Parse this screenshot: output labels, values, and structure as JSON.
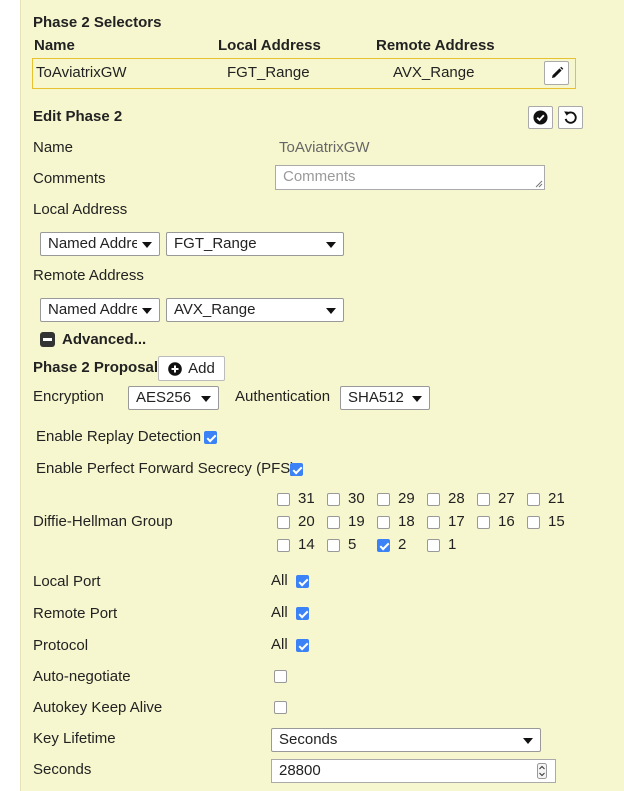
{
  "selectors": {
    "title": "Phase 2 Selectors",
    "columns": [
      "Name",
      "Local Address",
      "Remote Address"
    ],
    "row": {
      "name": "ToAviatrixGW",
      "local": "FGT_Range",
      "remote": "AVX_Range"
    }
  },
  "edit": {
    "title": "Edit Phase 2",
    "name_label": "Name",
    "name_value": "ToAviatrixGW",
    "comments_label": "Comments",
    "comments_placeholder": "Comments",
    "local_address_label": "Local Address",
    "local_type": "Named Address",
    "local_value": "FGT_Range",
    "remote_address_label": "Remote Address",
    "remote_type": "Named Address",
    "remote_value": "AVX_Range",
    "advanced_label": "Advanced..."
  },
  "proposal": {
    "title": "Phase 2 Proposal",
    "add_label": "Add",
    "encryption_label": "Encryption",
    "encryption_value": "AES256",
    "authentication_label": "Authentication",
    "authentication_value": "SHA512"
  },
  "options": {
    "replay_label": "Enable Replay Detection",
    "replay_checked": true,
    "pfs_label": "Enable Perfect Forward Secrecy (PFS)",
    "pfs_checked": true,
    "dh_label": "Diffie-Hellman Group",
    "dh_groups": [
      {
        "value": "31",
        "checked": false
      },
      {
        "value": "30",
        "checked": false
      },
      {
        "value": "29",
        "checked": false
      },
      {
        "value": "28",
        "checked": false
      },
      {
        "value": "27",
        "checked": false
      },
      {
        "value": "21",
        "checked": false
      },
      {
        "value": "20",
        "checked": false
      },
      {
        "value": "19",
        "checked": false
      },
      {
        "value": "18",
        "checked": false
      },
      {
        "value": "17",
        "checked": false
      },
      {
        "value": "16",
        "checked": false
      },
      {
        "value": "15",
        "checked": false
      },
      {
        "value": "14",
        "checked": false
      },
      {
        "value": "5",
        "checked": false
      },
      {
        "value": "2",
        "checked": true
      },
      {
        "value": "1",
        "checked": false
      }
    ]
  },
  "ports": {
    "local_port_label": "Local Port",
    "local_port_value": "All",
    "remote_port_label": "Remote Port",
    "remote_port_value": "All",
    "protocol_label": "Protocol",
    "protocol_value": "All",
    "auto_negotiate_label": "Auto-negotiate",
    "keep_alive_label": "Autokey Keep Alive",
    "key_lifetime_label": "Key Lifetime",
    "key_lifetime_value": "Seconds",
    "seconds_label": "Seconds",
    "seconds_value": "28800"
  },
  "colors": {
    "panel": "#f7f7cf",
    "highlight_border": "#e6c230",
    "checkbox": "#3b82f6"
  }
}
